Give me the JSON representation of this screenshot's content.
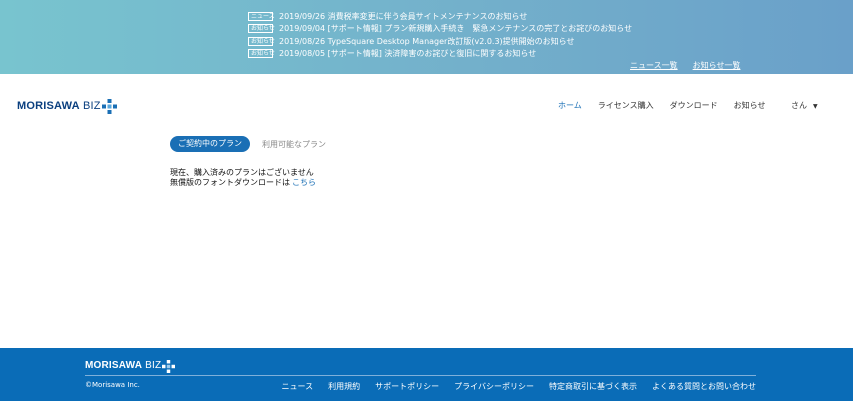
{
  "news": {
    "items": [
      {
        "tag": "ニュース",
        "text": "2019/09/26 消費税率変更に伴う会員サイトメンテナンスのお知らせ"
      },
      {
        "tag": "お知らせ",
        "text": "2019/09/04 [サポート情報] プラン新規購入手続き　緊急メンテナンスの完了とお詫びのお知らせ"
      },
      {
        "tag": "お知らせ",
        "text": "2019/08/26 TypeSquare Desktop Manager改訂版(v2.0.3)提供開始のお知らせ"
      },
      {
        "tag": "お知らせ",
        "text": "2019/08/05 [サポート情報] 決済障害のお詫びと復旧に関するお知らせ"
      }
    ],
    "links": {
      "news_list": "ニュース一覧",
      "info_list": "お知らせ一覧"
    }
  },
  "header": {
    "logo": {
      "main": "MORISAWA",
      "suffix": " BIZ"
    },
    "nav": {
      "home": "ホーム",
      "license": "ライセンス購入",
      "download": "ダウンロード",
      "info": "お知らせ"
    },
    "user_label": "さん",
    "caret": "▼"
  },
  "tabs": {
    "active": "ご契約中のプラン",
    "inactive": "利用可能なプラン"
  },
  "message": {
    "line1": "現在、購入済みのプランはございません",
    "line2": "無償版のフォントダウンロードは",
    "link": "こちら"
  },
  "footer": {
    "logo": {
      "main": "MORISAWA",
      "suffix": " BIZ"
    },
    "copyright": "©Morisawa Inc.",
    "links": [
      "ニュース",
      "利用規約",
      "サポートポリシー",
      "プライバシーポリシー",
      "特定商取引に基づく表示",
      "よくある質問とお問い合わせ"
    ]
  },
  "colors": {
    "brand_blue": "#0a6cb7",
    "logo_navy": "#0a3f7f",
    "topbar_teal": "#78c4cf"
  },
  "icons": {
    "logo_mark": "blue-plus-squares-icon"
  }
}
